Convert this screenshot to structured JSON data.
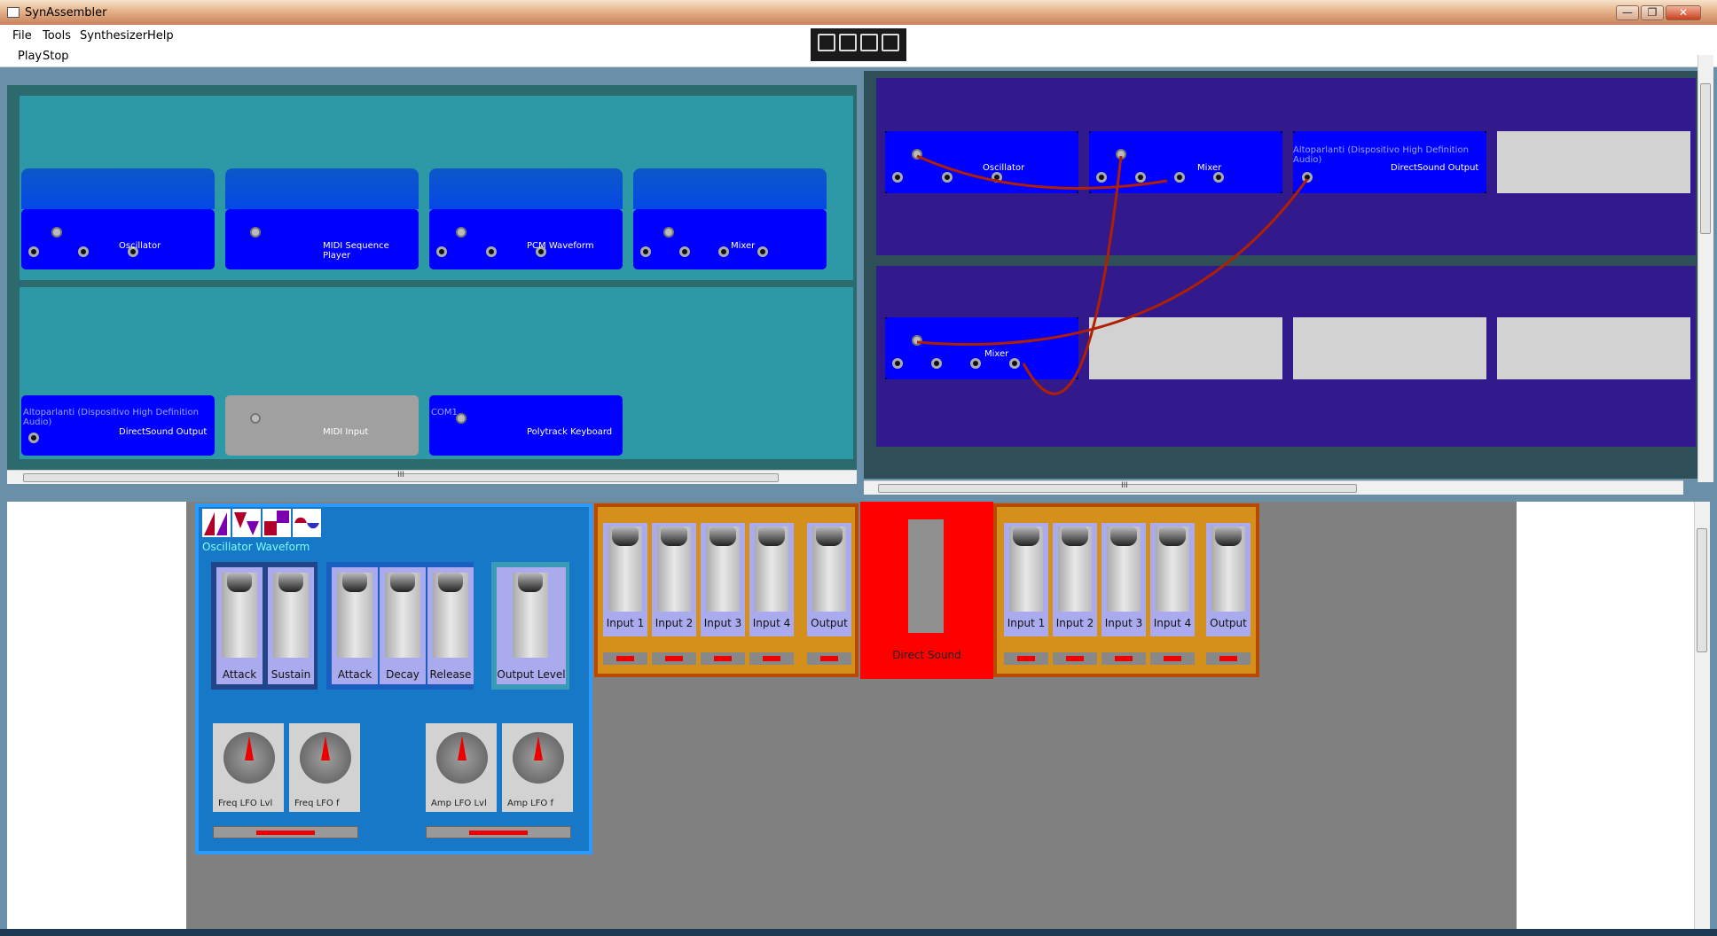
{
  "window": {
    "title": "SynAssembler",
    "min": "—",
    "max": "❐",
    "close": "✕"
  },
  "menu": [
    "File",
    "Tools",
    "Synthesizer",
    "Help"
  ],
  "toolbar": {
    "play": "Play",
    "stop": "Stop"
  },
  "left_rack": {
    "row1": [
      {
        "label": "Oscillator"
      },
      {
        "label": "MIDI Sequence Player"
      },
      {
        "label": "PCM Waveform"
      },
      {
        "label": "Mixer"
      }
    ],
    "row2": [
      {
        "label": "DirectSound Output",
        "sub": "Altoparlanti (Dispositivo High Definition Audio)"
      },
      {
        "label": "MIDI Input"
      },
      {
        "label": "Polytrack Keyboard",
        "sub": "COM1"
      }
    ],
    "scroll_grip": "III"
  },
  "right_rack": {
    "row1": [
      {
        "label": "Oscillator"
      },
      {
        "label": "Mixer"
      },
      {
        "label": "DirectSound Output",
        "sub": "Altoparlanti (Dispositivo High Definition Audio)"
      }
    ],
    "row2": [
      {
        "label": "Mixer"
      }
    ],
    "scroll_grip": "III"
  },
  "oscillator_panel": {
    "title": "Oscillator Waveform",
    "waveforms": [
      "sawtooth-wave-icon",
      "triangle-wave-icon",
      "square-wave-icon",
      "sine-wave-icon"
    ],
    "env1": [
      "Attack",
      "Sustain"
    ],
    "env2": [
      "Attack",
      "Decay",
      "Release"
    ],
    "output": "Output Level",
    "knobs": [
      "Freq LFO Lvl",
      "Freq LFO f",
      "Amp LFO Lvl",
      "Amp LFO f"
    ]
  },
  "mixer_a": {
    "channels": [
      "Input 1",
      "Input 2",
      "Input 3",
      "Input 4",
      "Output"
    ]
  },
  "direct_sound": {
    "label": "Direct Sound"
  },
  "mixer_b": {
    "channels": [
      "Input 1",
      "Input 2",
      "Input 3",
      "Input 4",
      "Output"
    ]
  },
  "colors": {
    "module_blue": "#0000ff",
    "cable": "#b02000",
    "mixer_orange": "#d4901a",
    "direct_red": "#ff0000"
  }
}
